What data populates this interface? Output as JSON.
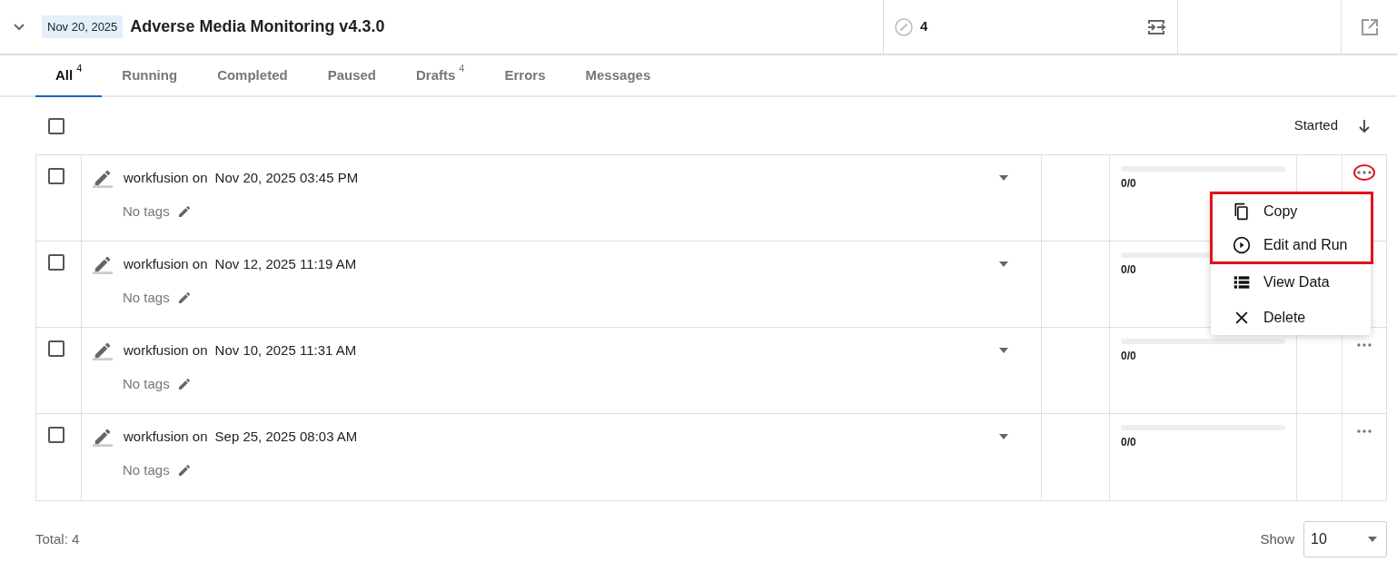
{
  "header": {
    "date_badge": "Nov 20, 2025",
    "title": "Adverse Media Monitoring v4.3.0",
    "count": "4"
  },
  "tabs": [
    {
      "label": "All",
      "count": "4",
      "selected": true
    },
    {
      "label": "Running",
      "selected": false
    },
    {
      "label": "Completed",
      "selected": false
    },
    {
      "label": "Paused",
      "selected": false
    },
    {
      "label": "Drafts",
      "count": "4",
      "selected": false
    },
    {
      "label": "Errors",
      "selected": false
    },
    {
      "label": "Messages",
      "selected": false
    }
  ],
  "list": {
    "select_all_checked": false,
    "sort_label": "Started"
  },
  "rows": [
    {
      "checked": false,
      "author": "workfusion on",
      "date": "Nov 20, 2025 03:45 PM",
      "tags": "No tags",
      "level": 0,
      "progress": "0/0",
      "menu_open": true,
      "highlighted": true
    },
    {
      "checked": false,
      "author": "workfusion on",
      "date": "Nov 12, 2025 11:19 AM",
      "tags": "No tags",
      "level": 0,
      "progress": "0/0",
      "menu_open": false
    },
    {
      "checked": false,
      "author": "workfusion on",
      "date": "Nov 10, 2025 11:31 AM",
      "tags": "No tags",
      "level": 0,
      "progress": "0/0",
      "menu_open": false,
      "highlighted": false
    },
    {
      "checked": false,
      "author": "workfusion on",
      "date": "Sep 25, 2025 08:03 AM",
      "tags": "No tags",
      "level": 0,
      "progress": "0/0",
      "menu_open": false,
      "highlighted": false
    }
  ],
  "menu": {
    "items": [
      {
        "kind": "copy",
        "label": "Copy",
        "highlighted": true
      },
      {
        "kind": "play",
        "label": "Edit and Run",
        "highlighted": true
      },
      {
        "kind": "list",
        "label": "View Data",
        "highlighted": false
      },
      {
        "kind": "delete",
        "label": "Delete",
        "highlighted": false
      }
    ]
  },
  "footer": {
    "total": "Total: 4",
    "show_label": "Show",
    "page_size": "10"
  }
}
